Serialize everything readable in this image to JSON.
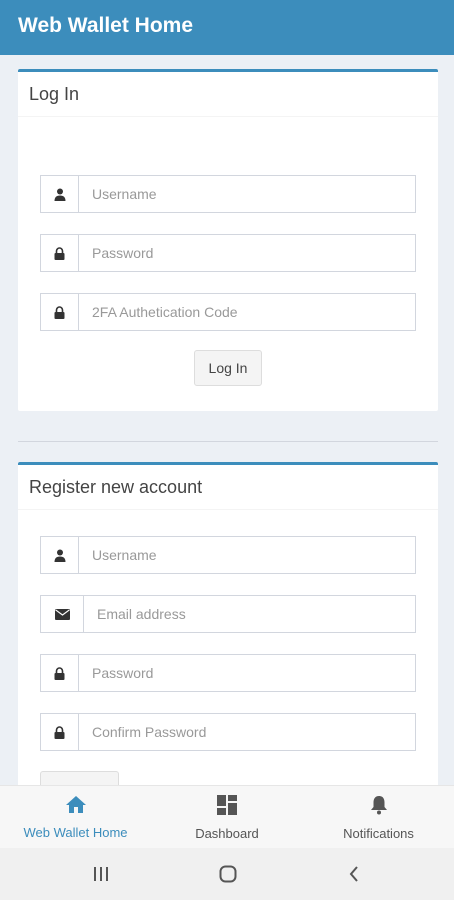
{
  "app": {
    "title": "Web Wallet Home"
  },
  "login": {
    "header": "Log In",
    "username_placeholder": "Username",
    "password_placeholder": "Password",
    "twofa_placeholder": "2FA Authetication Code",
    "submit_label": "Log In"
  },
  "register": {
    "header": "Register new account",
    "username_placeholder": "Username",
    "email_placeholder": "Email address",
    "password_placeholder": "Password",
    "confirm_placeholder": "Confirm Password"
  },
  "bottom_nav": {
    "items": [
      {
        "label": "Web Wallet Home",
        "icon": "home-icon",
        "active": true
      },
      {
        "label": "Dashboard",
        "icon": "dashboard-icon",
        "active": false
      },
      {
        "label": "Notifications",
        "icon": "bell-icon",
        "active": false
      }
    ]
  },
  "colors": {
    "accent": "#3c8dbc",
    "background": "#ecf0f5"
  }
}
